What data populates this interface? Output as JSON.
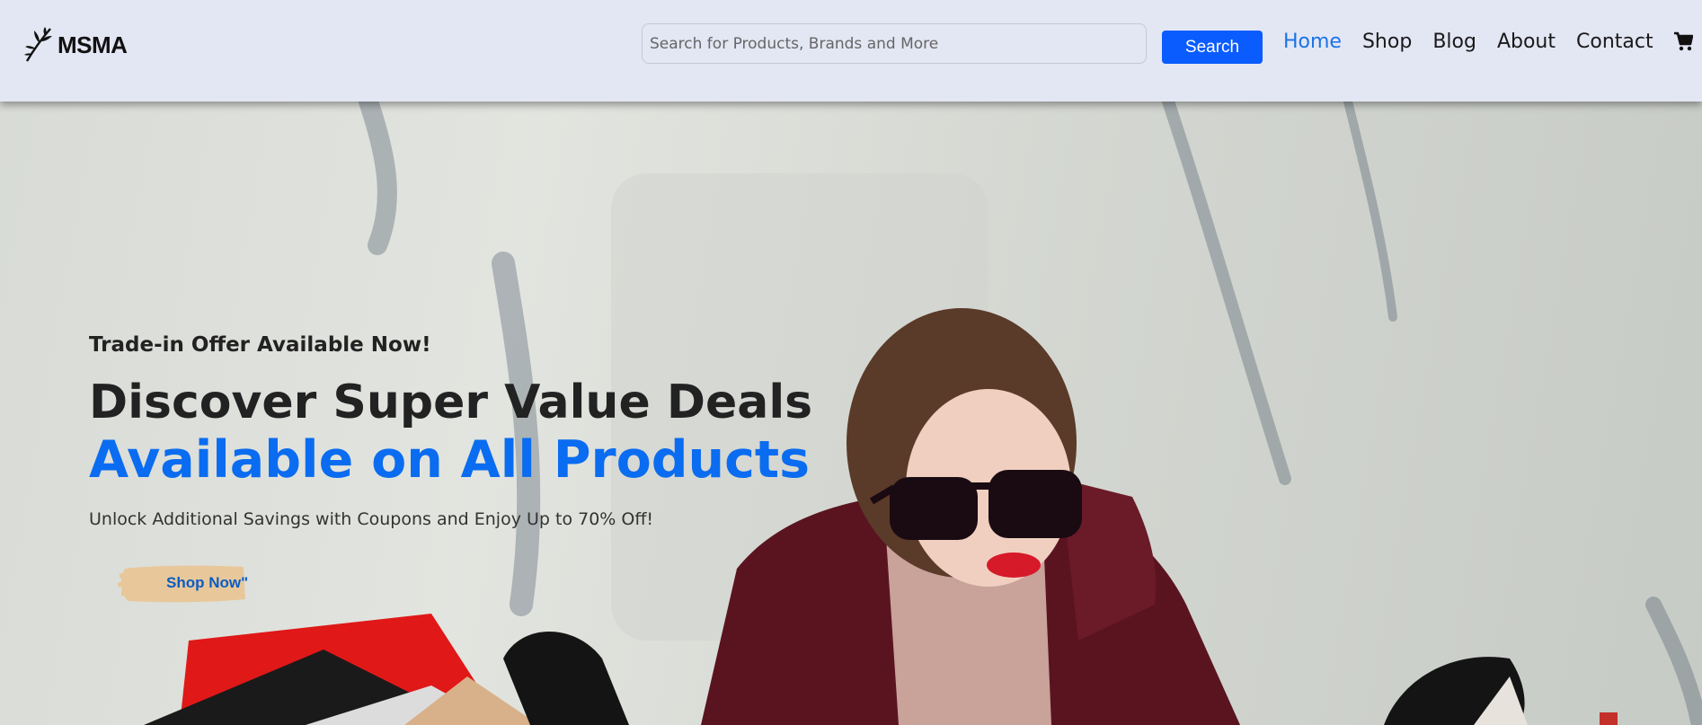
{
  "brand": {
    "name": "MSMA",
    "logo_icon": "feather-leaf-icon"
  },
  "search": {
    "placeholder": "Search for Products, Brands and More",
    "button_label": "Search"
  },
  "nav": {
    "items": [
      {
        "label": "Home",
        "active": true
      },
      {
        "label": "Shop",
        "active": false
      },
      {
        "label": "Blog",
        "active": false
      },
      {
        "label": "About",
        "active": false
      },
      {
        "label": "Contact",
        "active": false
      }
    ],
    "cart_icon": "cart-icon"
  },
  "hero": {
    "eyebrow": "Trade-in Offer Available Now!",
    "headline_line1": "Discover Super Value Deals",
    "headline_line2": "Available on All Products",
    "subtext": "Unlock Additional Savings with Coupons and Enjoy Up to 70% Off!",
    "cta_label": "Shop Now\""
  },
  "colors": {
    "header_bg": "#e3e6f3",
    "accent_blue": "#0a6cf0",
    "search_button": "#0a5cff",
    "cta_brush": "#e8c89a"
  }
}
